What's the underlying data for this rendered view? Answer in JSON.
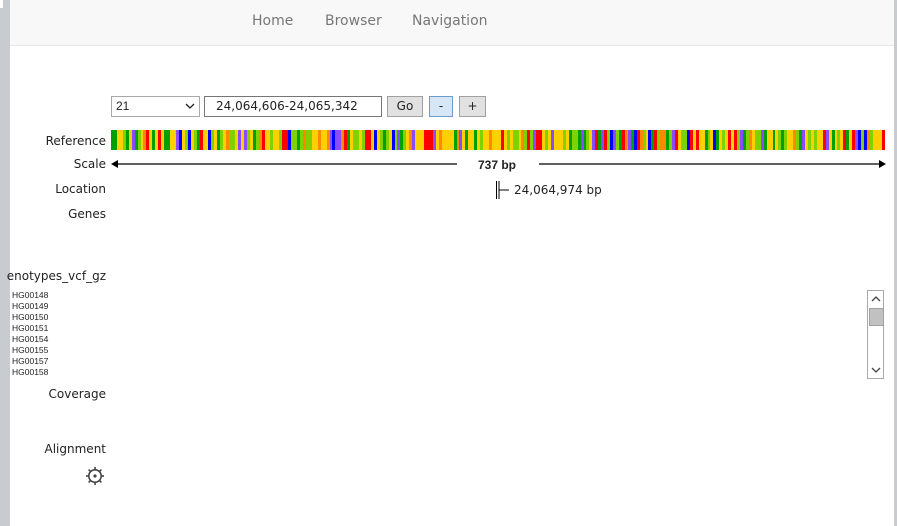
{
  "nav": {
    "home": "Home",
    "browser": "Browser",
    "navigation": "Navigation"
  },
  "controls": {
    "chromosome": "21",
    "locus": "24,064,606-24,065,342",
    "go_label": "Go",
    "zoom_out_label": "-",
    "zoom_in_label": "+"
  },
  "tracks": {
    "reference": "Reference",
    "scale": "Scale",
    "location": "Location",
    "genes": "Genes",
    "variants": "enotypes_vcf_gz",
    "coverage": "Coverage",
    "alignment": "Alignment"
  },
  "scale": {
    "span": "737 bp"
  },
  "location": {
    "position": "24,064,974 bp"
  },
  "samples": [
    "HG00148",
    "HG00149",
    "HG00150",
    "HG00151",
    "HG00154",
    "HG00155",
    "HG00157",
    "HG00158"
  ],
  "colors": {
    "A": "#ff0000",
    "C": "#0000ff",
    "G": "#d1a100",
    "T": "#00a000",
    "accent": "#6d9cc8"
  },
  "icons": {
    "settings": "gear-icon",
    "dropdown": "chevron-down-icon",
    "scroll_up": "chevron-up-icon",
    "scroll_down": "chevron-down-icon"
  }
}
